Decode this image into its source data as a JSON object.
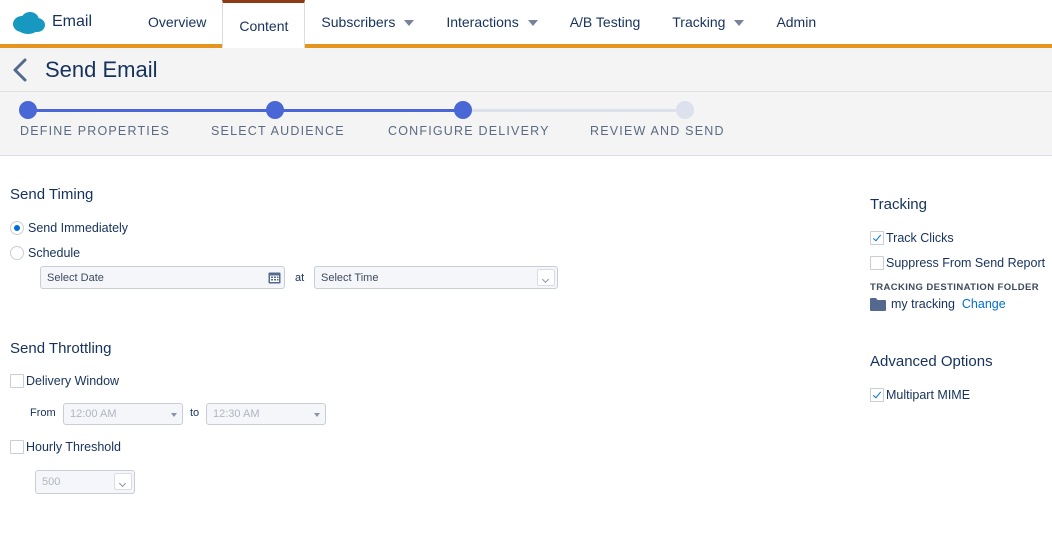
{
  "app": {
    "name": "Email",
    "brand_color": "#1798c1"
  },
  "nav": {
    "items": [
      {
        "label": "Overview"
      },
      {
        "label": "Content"
      },
      {
        "label": "Subscribers"
      },
      {
        "label": "Interactions"
      },
      {
        "label": "A/B Testing"
      },
      {
        "label": "Tracking"
      },
      {
        "label": "Admin"
      }
    ],
    "active": "Content",
    "accent": "#e5951f"
  },
  "header": {
    "title": "Send Email",
    "back_icon": "chevron-left-icon"
  },
  "stepper": {
    "steps": [
      {
        "label": "DEFINE PROPERTIES"
      },
      {
        "label": "SELECT AUDIENCE"
      },
      {
        "label": "CONFIGURE DELIVERY"
      },
      {
        "label": "REVIEW AND SEND"
      }
    ],
    "current_step": 3,
    "completed_color": "#4a67d6",
    "pending_color": "#dde1ee"
  },
  "send_timing": {
    "title": "Send Timing",
    "immediately_label": "Send Immediately",
    "immediately_selected": true,
    "schedule_label": "Schedule",
    "schedule_selected": false,
    "date_placeholder": "Select Date",
    "at_label": "at",
    "time_placeholder": "Select Time"
  },
  "send_throttling": {
    "title": "Send Throttling",
    "delivery_window_label": "Delivery Window",
    "delivery_window_checked": false,
    "from_label": "From",
    "from_value": "12:00 AM",
    "to_label": "to",
    "to_value": "12:30 AM",
    "hourly_threshold_label": "Hourly Threshold",
    "hourly_threshold_checked": false,
    "threshold_value": "500"
  },
  "tracking": {
    "title": "Tracking",
    "track_clicks_label": "Track Clicks",
    "track_clicks_checked": true,
    "suppress_label": "Suppress From Send Report",
    "suppress_checked": false,
    "destination_folder_label": "TRACKING DESTINATION FOLDER",
    "folder_name": "my tracking",
    "change_link": "Change"
  },
  "advanced": {
    "title": "Advanced Options",
    "multipart_label": "Multipart MIME",
    "multipart_checked": true
  }
}
